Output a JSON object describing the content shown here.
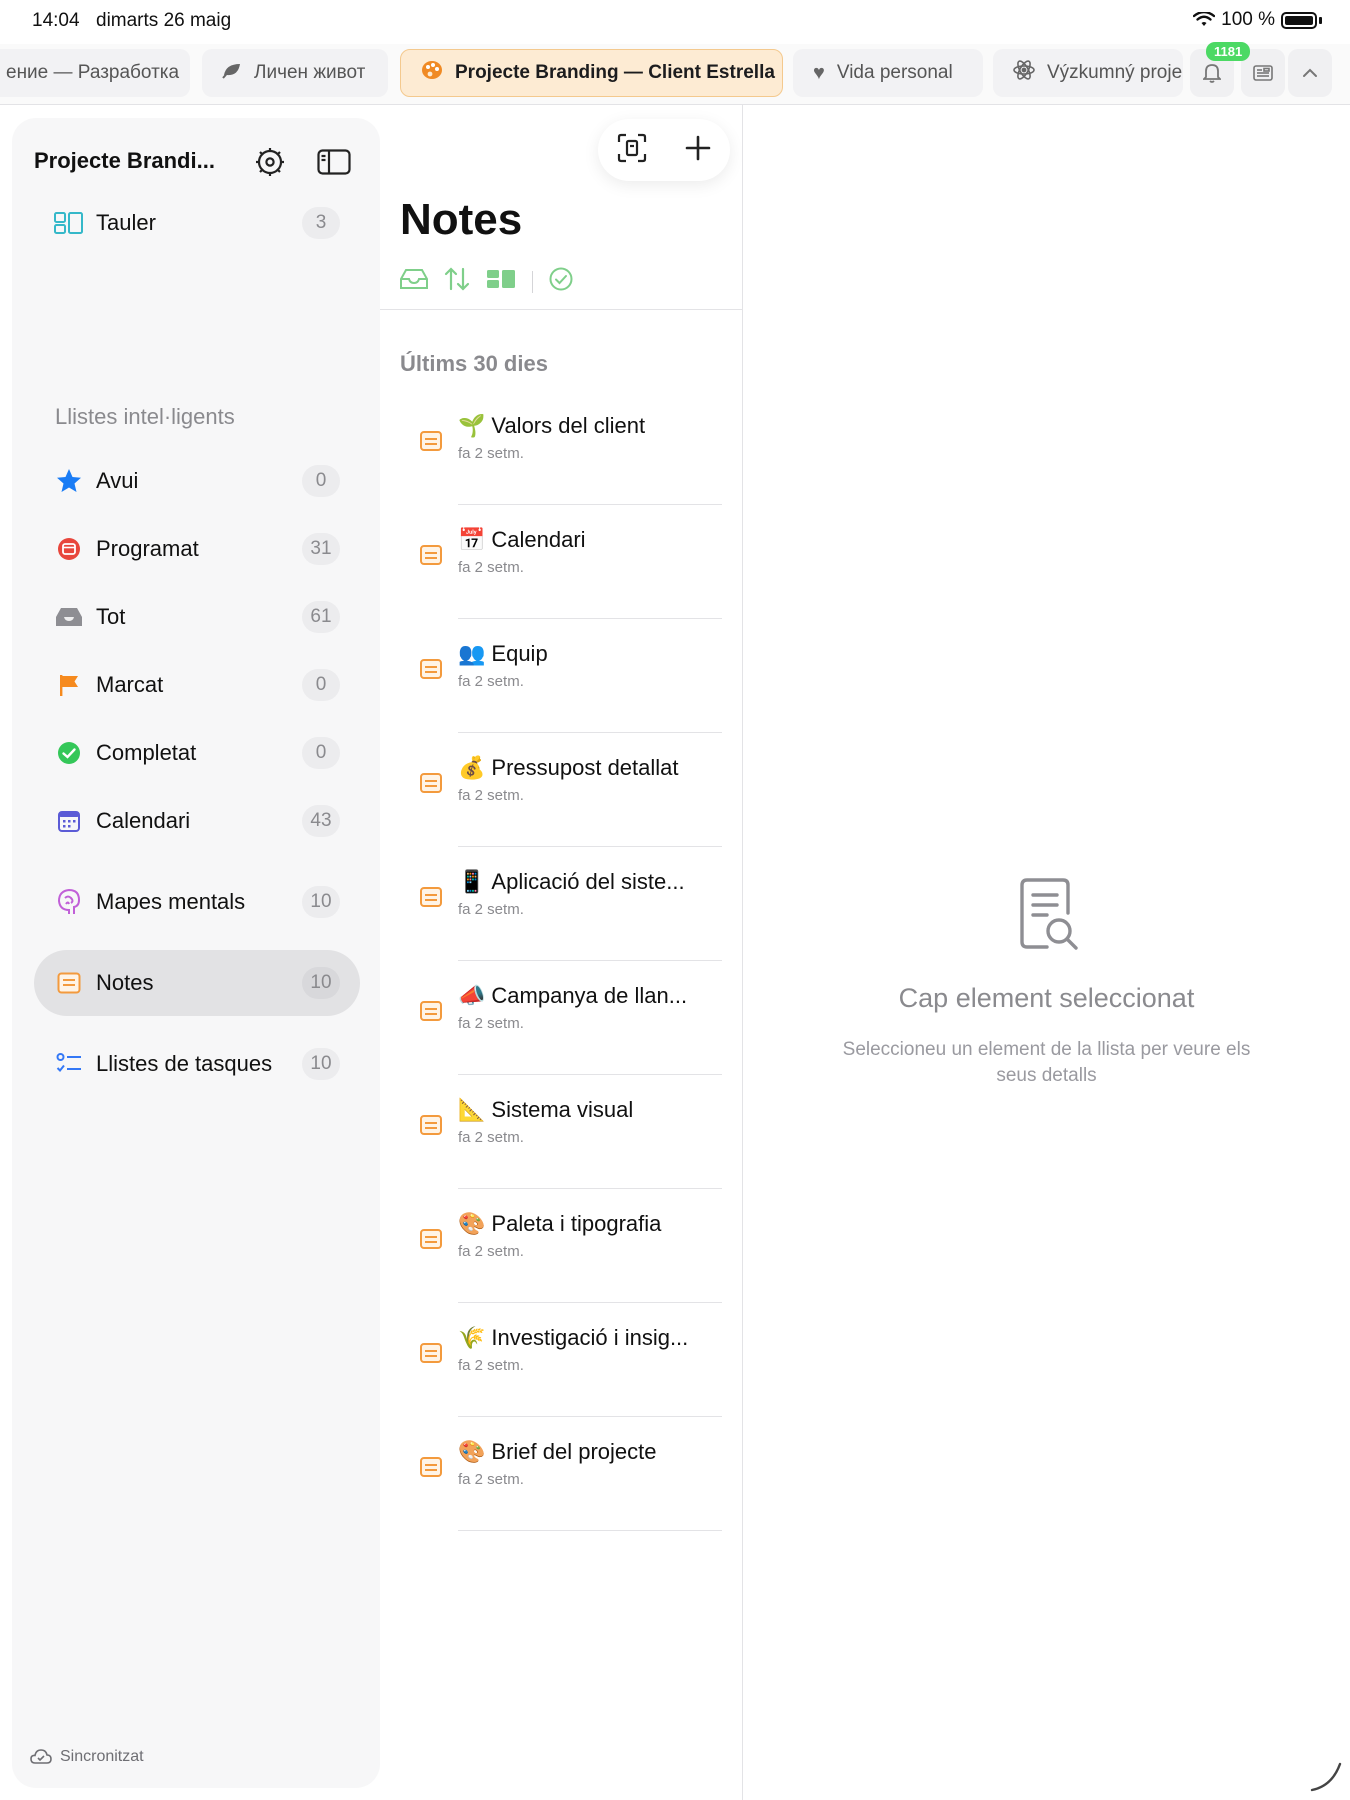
{
  "status_bar": {
    "time": "14:04",
    "date": "dimarts 26 maig",
    "battery": "100 %"
  },
  "tabs": [
    {
      "label": "ение — Разработка",
      "icon": "code-icon"
    },
    {
      "label": "Личен живот",
      "icon": "leaf-icon"
    },
    {
      "label": "Projecte Branding — Client Estrella",
      "icon": "palette-icon",
      "active": true
    },
    {
      "label": "Vida personal",
      "icon": "heart-icon"
    },
    {
      "label": "Výzkumný proje",
      "icon": "atom-icon"
    }
  ],
  "tab_actions": {
    "notification_badge": "1181"
  },
  "sidebar": {
    "title": "Projecte Brandi...",
    "board": {
      "label": "Tauler",
      "count": "3"
    },
    "smart_lists_header": "Llistes intel·ligents",
    "items": [
      {
        "label": "Avui",
        "count": "0",
        "icon": "star-icon"
      },
      {
        "label": "Programat",
        "count": "31",
        "icon": "calendar-clock-icon"
      },
      {
        "label": "Tot",
        "count": "61",
        "icon": "tray-icon"
      },
      {
        "label": "Marcat",
        "count": "0",
        "icon": "flag-icon"
      },
      {
        "label": "Completat",
        "count": "0",
        "icon": "checkmark-circle-icon"
      },
      {
        "label": "Calendari",
        "count": "43",
        "icon": "calendar-icon"
      }
    ],
    "collections": [
      {
        "label": "Mapes mentals",
        "count": "10",
        "icon": "brain-icon"
      },
      {
        "label": "Notes",
        "count": "10",
        "icon": "note-icon",
        "selected": true
      },
      {
        "label": "Llistes de tasques",
        "count": "10",
        "icon": "checklist-icon"
      }
    ],
    "footer": "Sincronitzat"
  },
  "list": {
    "title": "Notes",
    "section": "Últims 30 dies",
    "notes": [
      {
        "emoji": "🌱",
        "title": "Valors del client",
        "subtitle": "fa 2 setm."
      },
      {
        "emoji": "📅",
        "title": "Calendari",
        "subtitle": "fa 2 setm."
      },
      {
        "emoji": "👥",
        "title": "Equip",
        "subtitle": "fa 2 setm."
      },
      {
        "emoji": "💰",
        "title": "Pressupost detallat",
        "subtitle": "fa 2 setm."
      },
      {
        "emoji": "📱",
        "title": "Aplicació del siste...",
        "subtitle": "fa 2 setm."
      },
      {
        "emoji": "📣",
        "title": "Campanya de llan...",
        "subtitle": "fa 2 setm."
      },
      {
        "emoji": "📐",
        "title": "Sistema visual",
        "subtitle": "fa 2 setm."
      },
      {
        "emoji": "🎨",
        "title": "Paleta i tipografia",
        "subtitle": "fa 2 setm."
      },
      {
        "emoji": "🌾",
        "title": "Investigació i insig...",
        "subtitle": "fa 2 setm."
      },
      {
        "emoji": "🎨",
        "title": "Brief del projecte",
        "subtitle": "fa 2 setm."
      }
    ]
  },
  "detail": {
    "empty_title": "Cap element seleccionat",
    "empty_subtitle": "Seleccioneu un element de la llista per veure els seus detalls"
  },
  "colors": {
    "accent_orange": "#f08a24",
    "accent_green": "#7fcf8a",
    "badge_green": "#4cd964",
    "selected_bg": "#e2e2e4"
  }
}
